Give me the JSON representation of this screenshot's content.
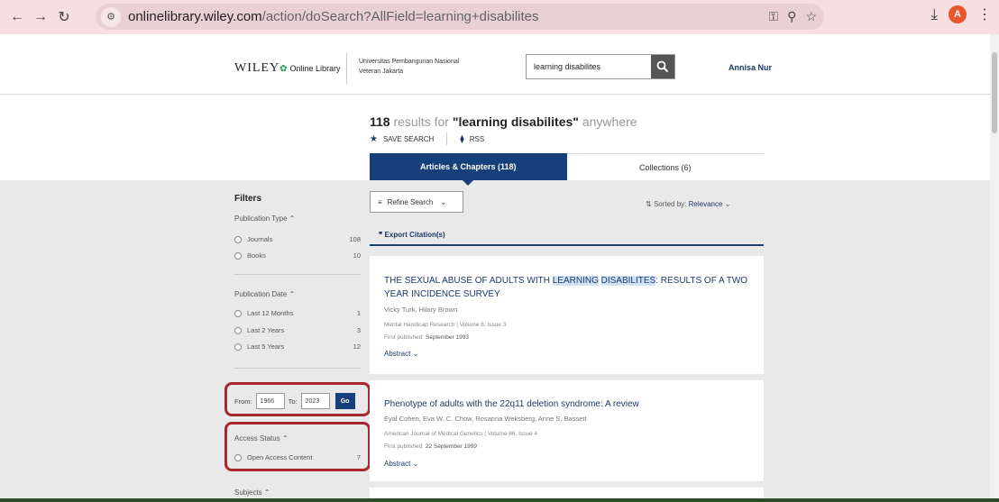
{
  "browser": {
    "url_domain": "onlinelibrary.wiley.com",
    "url_path": "/action/doSearch?AllField=learning+disabilites",
    "avatar_letter": "A"
  },
  "header": {
    "logo": "WILEY",
    "logo_suffix": "Online Library",
    "institution_line1": "Universitas Pembangunan Nasional",
    "institution_line2": "Veteran Jakarta",
    "search_value": "learning disabilites",
    "user_name": "Annisa Nur"
  },
  "results": {
    "count": "118",
    "text_results_for": "results for",
    "query": "\"learning disabilites\"",
    "text_anywhere": "anywhere",
    "save_search": "SAVE SEARCH",
    "rss": "RSS"
  },
  "tabs": [
    {
      "label": "Articles & Chapters (118)"
    },
    {
      "label": "Collections (6)"
    }
  ],
  "filters": {
    "title": "Filters",
    "publication_type": {
      "label": "Publication Type",
      "items": [
        {
          "label": "Journals",
          "count": "108"
        },
        {
          "label": "Books",
          "count": "10"
        }
      ]
    },
    "publication_date": {
      "label": "Publication Date",
      "items": [
        {
          "label": "Last 12 Months",
          "count": "1"
        },
        {
          "label": "Last 2 Years",
          "count": "3"
        },
        {
          "label": "Last 5 Years",
          "count": "12"
        }
      ]
    },
    "range": {
      "from_label": "From:",
      "from_value": "1966",
      "to_label": "To:",
      "to_value": "2023",
      "go": "Go"
    },
    "access_status": {
      "label": "Access Status",
      "items": [
        {
          "label": "Open Access Content",
          "count": "7"
        }
      ]
    },
    "subjects": {
      "label": "Subjects"
    }
  },
  "toolbar": {
    "refine": "Refine Search",
    "sorted_by": "Sorted by:",
    "sorted_value": "Relevance",
    "export": "Export Citation(s)"
  },
  "articles": [
    {
      "title_pre": "THE SEXUAL ABUSE OF ADULTS WITH ",
      "title_hl1": "LEARNING",
      "title_hl2": "DISABILITES",
      "title_post": ": RESULTS OF A TWO YEAR INCIDENCE SURVEY",
      "authors": "Vicky Turk, Hilary Brown",
      "source": "Mental Handicap Research | Volume 6, Issue 3",
      "first_published_label": "First published:",
      "first_published": "September 1993",
      "abstract": "Abstract"
    },
    {
      "title": "Phenotype of adults with the 22q11 deletion syndrome: A review",
      "authors": "Eyal Cohen, Eva W. C. Chow, Rosanna Weksberg, Anne S. Bassett",
      "source": "American Journal of Medical Genetics | Volume 86, Issue 4",
      "first_published_label": "First published:",
      "first_published": "22 September 1999",
      "abstract": "Abstract"
    }
  ],
  "colors": {
    "wiley_blue": "#17407a",
    "highlight_box": "#a9262a",
    "chrome": "#f6dfe3"
  }
}
